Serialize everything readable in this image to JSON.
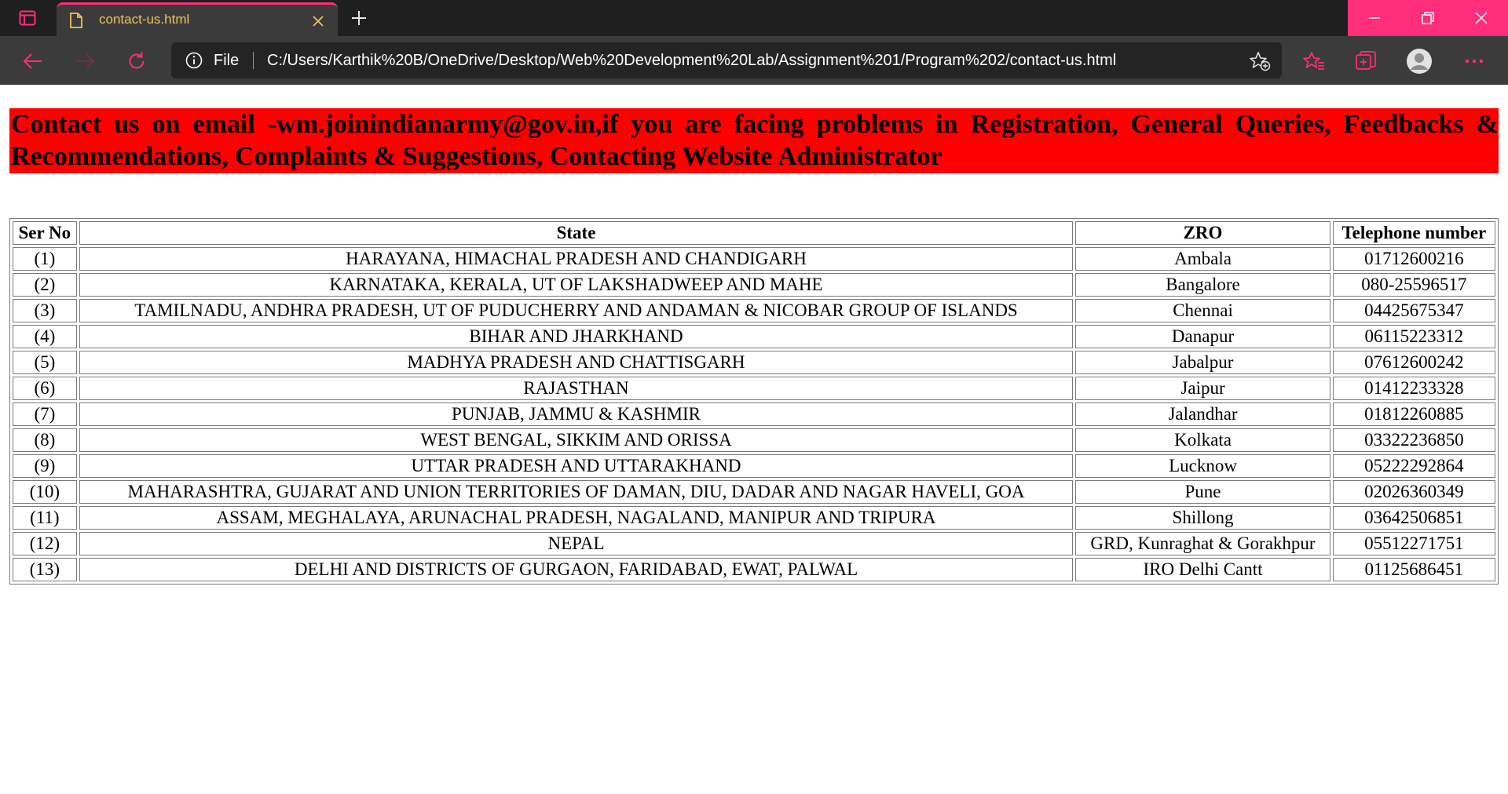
{
  "browser": {
    "tab_title": "contact-us.html",
    "scheme_label": "File",
    "url": "C:/Users/Karthik%20B/OneDrive/Desktop/Web%20Development%20Lab/Assignment%201/Program%202/contact-us.html",
    "accent_color": "#ff2e7a",
    "tab_title_color": "#f0c25a"
  },
  "page": {
    "banner_text": "Contact us on email -wm.joinindianarmy@gov.in,if you are facing problems in Registration, General Queries, Feedbacks & Recommendations, Complaints & Suggestions, Contacting Website Administrator",
    "banner_color": "#ff0000",
    "table": {
      "headers": {
        "ser_no": "Ser No",
        "state": "State",
        "zro": "ZRO",
        "telephone": "Telephone number"
      },
      "rows": [
        {
          "ser": "(1)",
          "state": "HARAYANA, HIMACHAL PRADESH AND CHANDIGARH",
          "zro": "Ambala",
          "tel": "01712600216"
        },
        {
          "ser": "(2)",
          "state": "KARNATAKA, KERALA, UT OF LAKSHADWEEP AND MAHE",
          "zro": "Bangalore",
          "tel": "080-25596517"
        },
        {
          "ser": "(3)",
          "state": "TAMILNADU, ANDHRA PRADESH, UT OF PUDUCHERRY AND ANDAMAN & NICOBAR GROUP OF ISLANDS",
          "zro": "Chennai",
          "tel": "04425675347"
        },
        {
          "ser": "(4)",
          "state": "BIHAR AND JHARKHAND",
          "zro": "Danapur",
          "tel": "06115223312"
        },
        {
          "ser": "(5)",
          "state": "MADHYA PRADESH AND CHATTISGARH",
          "zro": "Jabalpur",
          "tel": "07612600242"
        },
        {
          "ser": "(6)",
          "state": "RAJASTHAN",
          "zro": "Jaipur",
          "tel": "01412233328"
        },
        {
          "ser": "(7)",
          "state": "PUNJAB, JAMMU & KASHMIR",
          "zro": "Jalandhar",
          "tel": "01812260885"
        },
        {
          "ser": "(8)",
          "state": "WEST BENGAL, SIKKIM AND ORISSA",
          "zro": "Kolkata",
          "tel": "03322236850"
        },
        {
          "ser": "(9)",
          "state": "UTTAR PRADESH AND UTTARAKHAND",
          "zro": "Lucknow",
          "tel": "05222292864"
        },
        {
          "ser": "(10)",
          "state": "MAHARASHTRA, GUJARAT AND UNION TERRITORIES OF DAMAN, DIU, DADAR AND NAGAR HAVELI, GOA",
          "zro": "Pune",
          "tel": "02026360349"
        },
        {
          "ser": "(11)",
          "state": "ASSAM, MEGHALAYA, ARUNACHAL PRADESH, NAGALAND, MANIPUR AND TRIPURA",
          "zro": "Shillong",
          "tel": "03642506851"
        },
        {
          "ser": "(12)",
          "state": "NEPAL",
          "zro": "GRD, Kunraghat & Gorakhpur",
          "tel": "05512271751"
        },
        {
          "ser": "(13)",
          "state": "DELHI AND DISTRICTS OF GURGAON, FARIDABAD, EWAT, PALWAL",
          "zro": "IRO Delhi Cantt",
          "tel": "01125686451"
        }
      ]
    }
  },
  "icons": {
    "tab_actions": "tab-actions-icon",
    "favicon": "file-icon",
    "tab_close": "close-icon",
    "new_tab": "plus-icon",
    "minimize": "minimize-icon",
    "restore": "restore-icon",
    "window_close": "close-icon",
    "back": "arrow-left-icon",
    "forward": "arrow-right-icon",
    "reload": "reload-icon",
    "site_info": "info-icon",
    "add_favorite": "star-plus-icon",
    "favorites": "favorites-icon",
    "collections": "collections-icon",
    "profile": "avatar-icon",
    "menu": "ellipsis-icon"
  }
}
